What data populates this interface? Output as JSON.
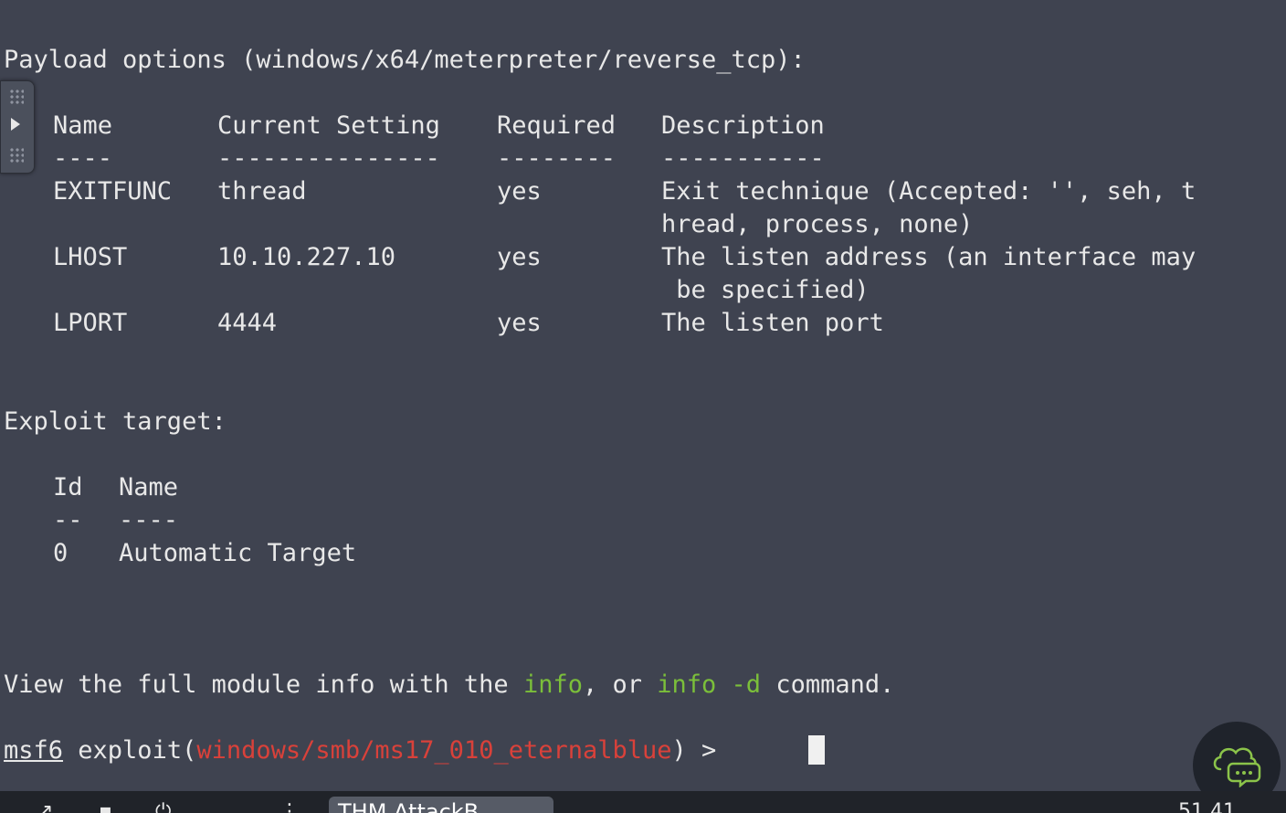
{
  "terminal": {
    "payload_header": "Payload options (windows/x64/meterpreter/reverse_tcp):",
    "payload_table": {
      "headers": [
        "Name",
        "Current Setting",
        "Required",
        "Description"
      ],
      "underlines": [
        "----",
        "---------------",
        "--------",
        "-----------"
      ],
      "rows": [
        {
          "name": "EXITFUNC",
          "setting": "thread",
          "required": "yes",
          "desc1": "Exit technique (Accepted: '', seh, t",
          "desc2": "hread, process, none)"
        },
        {
          "name": "LHOST",
          "setting": "10.10.227.10",
          "required": "yes",
          "desc1": "The listen address (an interface may",
          "desc2": " be specified)"
        },
        {
          "name": "LPORT",
          "setting": "4444",
          "required": "yes",
          "desc1": "The listen port",
          "desc2": ""
        }
      ]
    },
    "target_header": "Exploit target:",
    "target_table": {
      "headers": [
        "Id",
        "Name"
      ],
      "underlines": [
        "--",
        "----"
      ],
      "rows": [
        {
          "id": "0",
          "name": "Automatic Target"
        }
      ]
    },
    "info_line": {
      "part1": "View the full module info with the ",
      "cmd1": "info",
      "part2": ", or ",
      "cmd2": "info -d",
      "part3": " command."
    },
    "prompt": {
      "msf": "msf6",
      "exploit_prefix": " exploit(",
      "module": "windows/smb/ms17_010_eternalblue",
      "suffix": ") > "
    }
  },
  "taskbar": {
    "active_tab_label": "THM AttackB",
    "clock_fragment": "51   41"
  },
  "colors": {
    "background": "#3f4350",
    "green": "#7bbf3a",
    "red": "#d9413a"
  },
  "icons": {
    "side_handle": "panel-toggle-icon",
    "chat": "chat-support-icon"
  }
}
